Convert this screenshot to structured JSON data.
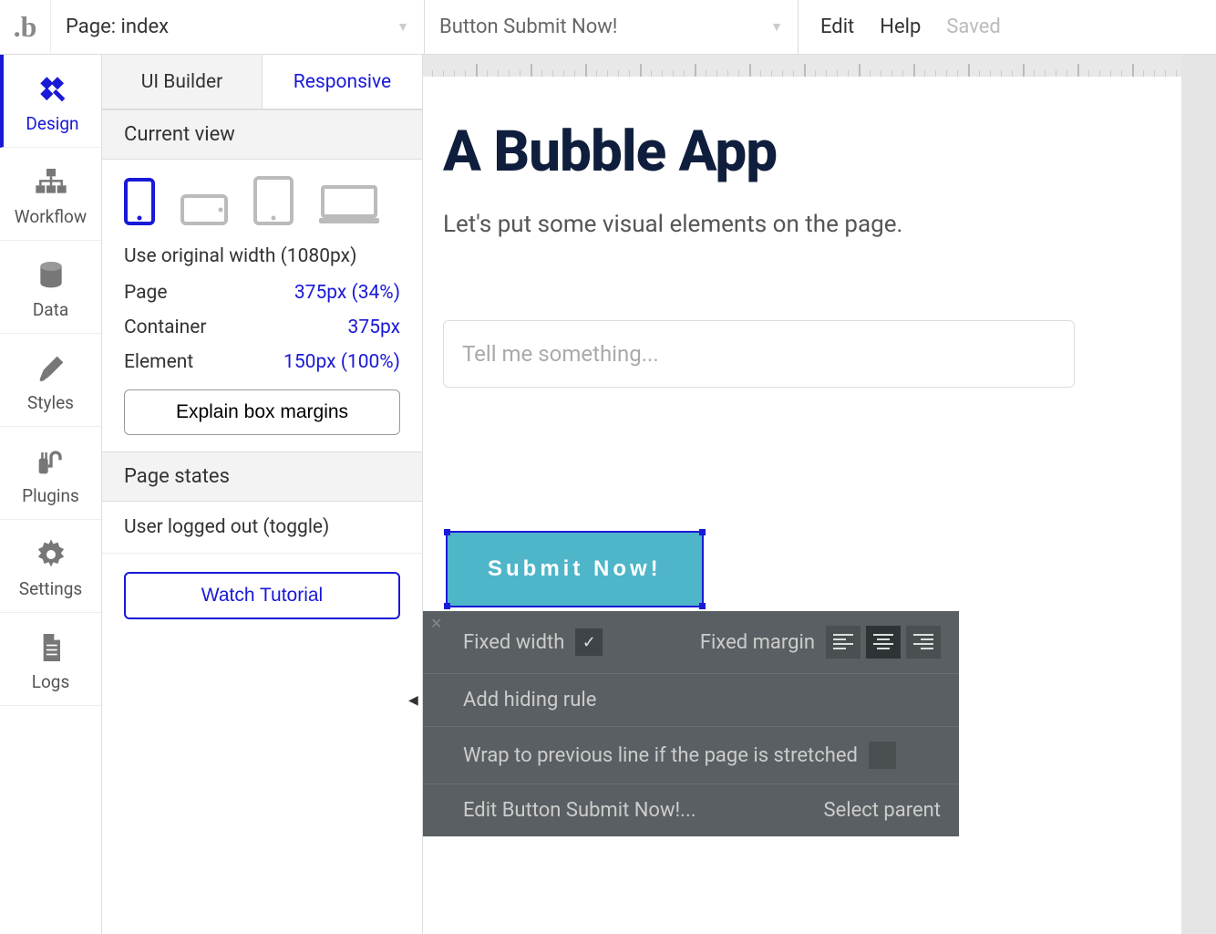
{
  "topbar": {
    "page_label": "Page: index",
    "element_label": "Button Submit Now!",
    "edit": "Edit",
    "help": "Help",
    "saved": "Saved"
  },
  "leftnav": {
    "design": "Design",
    "workflow": "Workflow",
    "data": "Data",
    "styles": "Styles",
    "plugins": "Plugins",
    "settings": "Settings",
    "logs": "Logs"
  },
  "panel": {
    "tab_ui": "UI Builder",
    "tab_responsive": "Responsive",
    "current_view": "Current view",
    "use_original_width": "Use original width (1080px)",
    "metrics": {
      "page_label": "Page",
      "page_val": "375px (34%)",
      "container_label": "Container",
      "container_val": "375px",
      "element_label": "Element",
      "element_val": "150px (100%)"
    },
    "explain_box_margins": "Explain box margins",
    "page_states": "Page states",
    "user_logged_out": "User logged out (toggle)",
    "watch_tutorial": "Watch Tutorial"
  },
  "canvas": {
    "title": "A Bubble App",
    "subtitle": "Let's put some visual elements on the page.",
    "input_placeholder": "Tell me something...",
    "submit_label": "Submit Now!"
  },
  "float": {
    "fixed_width": "Fixed width",
    "fixed_margin": "Fixed margin",
    "add_hiding_rule": "Add hiding rule",
    "wrap_text": "Wrap to previous line if the page is stretched",
    "edit_label": "Edit Button Submit Now!...",
    "select_parent": "Select parent"
  }
}
